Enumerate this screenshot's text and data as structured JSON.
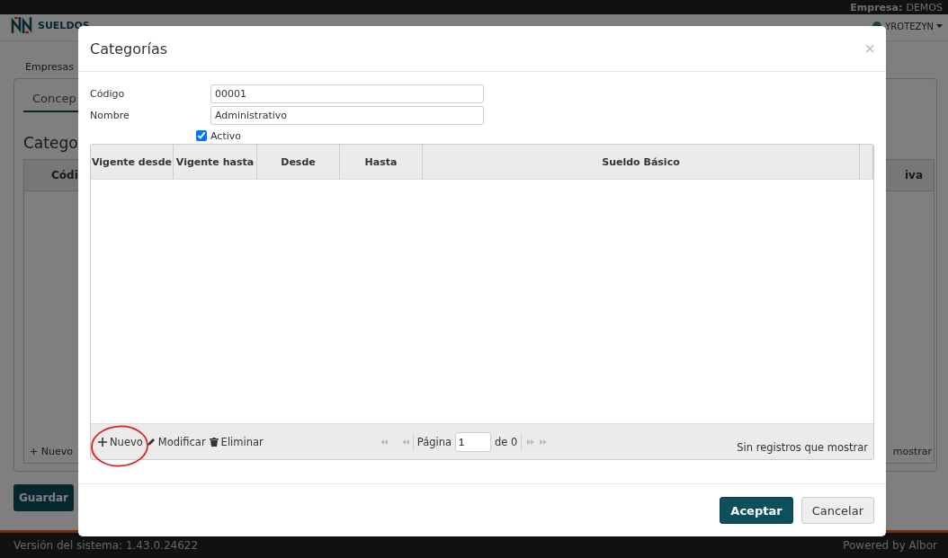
{
  "top_bar": {
    "company_label": "Empresa:",
    "company": "DEMOS"
  },
  "header": {
    "logo_text": "SUELDOS",
    "user": "YROTEZYN"
  },
  "background": {
    "breadcrumb": "Empresas",
    "tab": "Concep",
    "heading": "Catego",
    "column_1": "Códi",
    "column_2": "iva",
    "new_button": "+ Nuevo",
    "status": "mostrar",
    "save_button": "Guardar"
  },
  "footer": {
    "version": "Versión del sistema: 1.43.0.24622",
    "powered": "Powered by Albor"
  },
  "dialog": {
    "title": "Categorías",
    "close": "×",
    "fields": [
      {
        "label": "Código",
        "value": "00001"
      },
      {
        "label": "Nombre",
        "value": "Administrativo"
      }
    ],
    "active": {
      "label": "Activo",
      "checked": true
    },
    "table": {
      "columns": [
        "Vigente desde",
        "Vigente hasta",
        "Desde",
        "Hasta",
        "Sueldo Básico"
      ]
    },
    "toolbar": [
      {
        "kind": "plus",
        "label": "Nuevo",
        "annotated": true
      },
      {
        "kind": "pencil",
        "label": "Modificar",
        "annotated": false
      },
      {
        "kind": "trash",
        "label": "Eliminar",
        "annotated": false
      }
    ],
    "pager": {
      "page_label": "Página",
      "page": "1",
      "of": "de 0",
      "status": "Sin registros que mostrar"
    },
    "buttons": [
      {
        "label": "Aceptar",
        "kind": "primary"
      },
      {
        "label": "Cancelar",
        "kind": "secondary"
      }
    ]
  }
}
